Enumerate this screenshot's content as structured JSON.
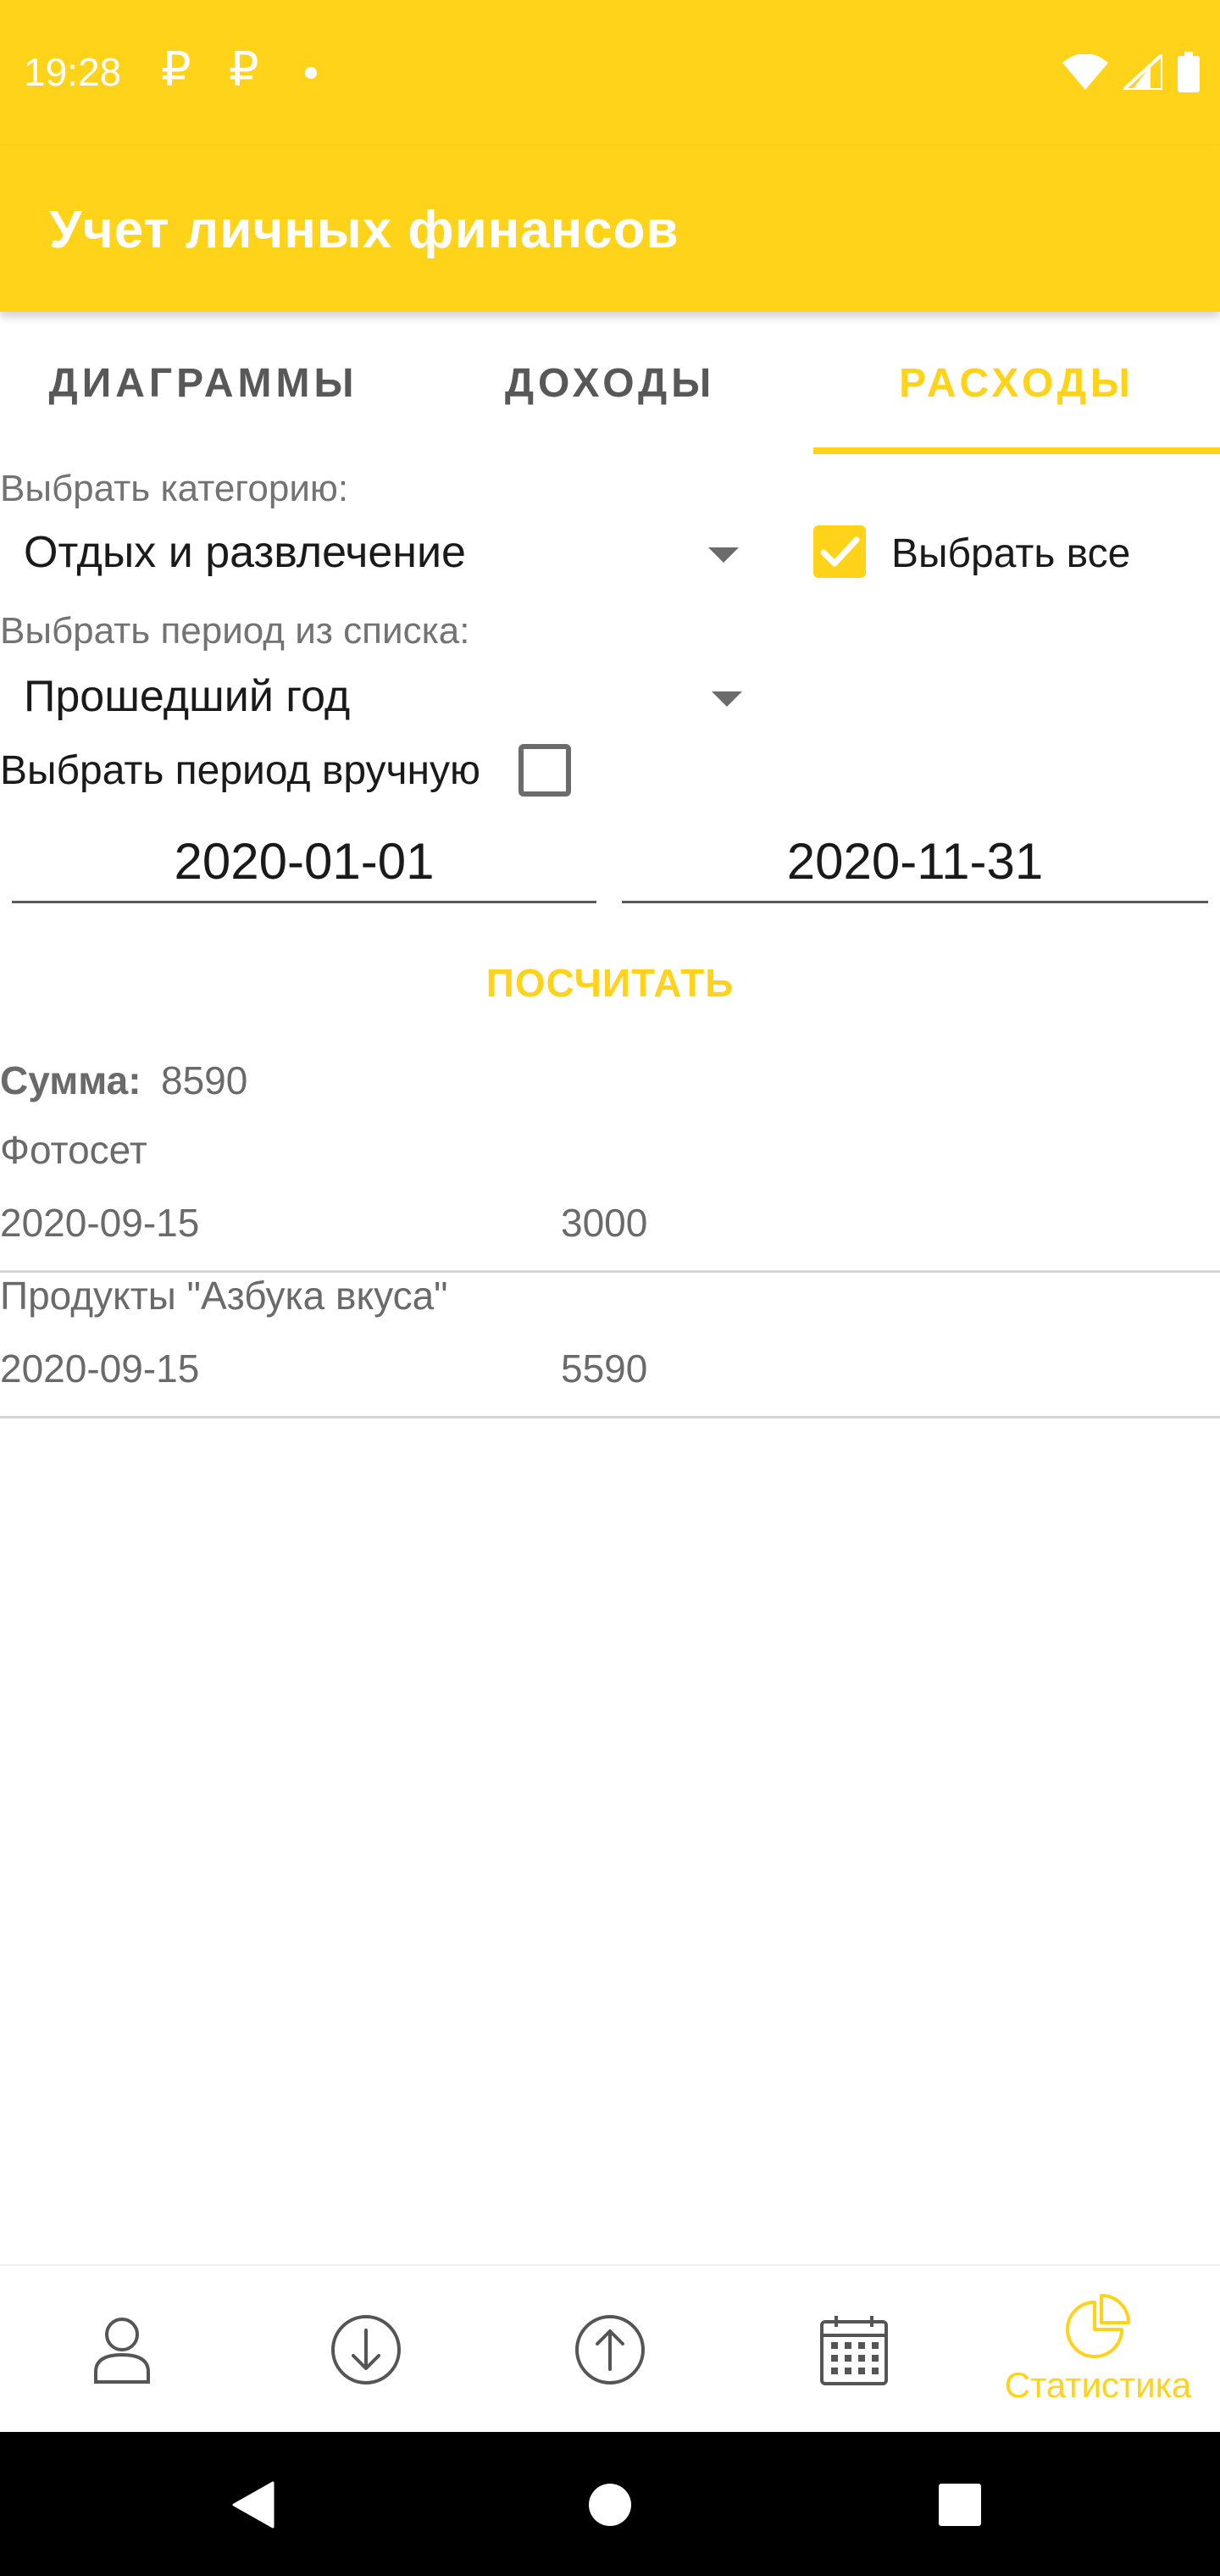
{
  "status_bar": {
    "time": "19:28",
    "notif_icon_1": "₽",
    "notif_icon_2": "₽"
  },
  "app_bar": {
    "title": "Учет личных финансов"
  },
  "tabs": [
    {
      "label": "ДИАГРАММЫ",
      "active": false
    },
    {
      "label": "ДОХОДЫ",
      "active": false
    },
    {
      "label": "РАСХОДЫ",
      "active": true
    }
  ],
  "filters": {
    "category_label": "Выбрать категорию:",
    "category_value": "Отдых и развлечение",
    "select_all_label": "Выбрать все",
    "select_all_checked": true,
    "period_label": "Выбрать период из списка:",
    "period_value": "Прошедший год",
    "manual_period_label": "Выбрать период вручную",
    "manual_period_checked": false,
    "date_from": "2020-01-01",
    "date_to": "2020-11-31"
  },
  "calculate_button": "ПОСЧИТАТЬ",
  "summary": {
    "label": "Сумма:",
    "value": "8590"
  },
  "entries": [
    {
      "name": "Фотосет",
      "date": "2020-09-15",
      "amount": "3000"
    },
    {
      "name": "Продукты \"Азбука вкуса\"",
      "date": "2020-09-15",
      "amount": "5590"
    }
  ],
  "bottom_nav": {
    "items": [
      {
        "icon": "person-icon"
      },
      {
        "icon": "arrow-down-circle-icon"
      },
      {
        "icon": "arrow-up-circle-icon"
      },
      {
        "icon": "calendar-icon"
      },
      {
        "icon": "pie-chart-icon",
        "label": "Статистика",
        "active": true
      }
    ]
  },
  "colors": {
    "accent": "#FFD31A",
    "text_secondary": "#6a6a6a"
  }
}
